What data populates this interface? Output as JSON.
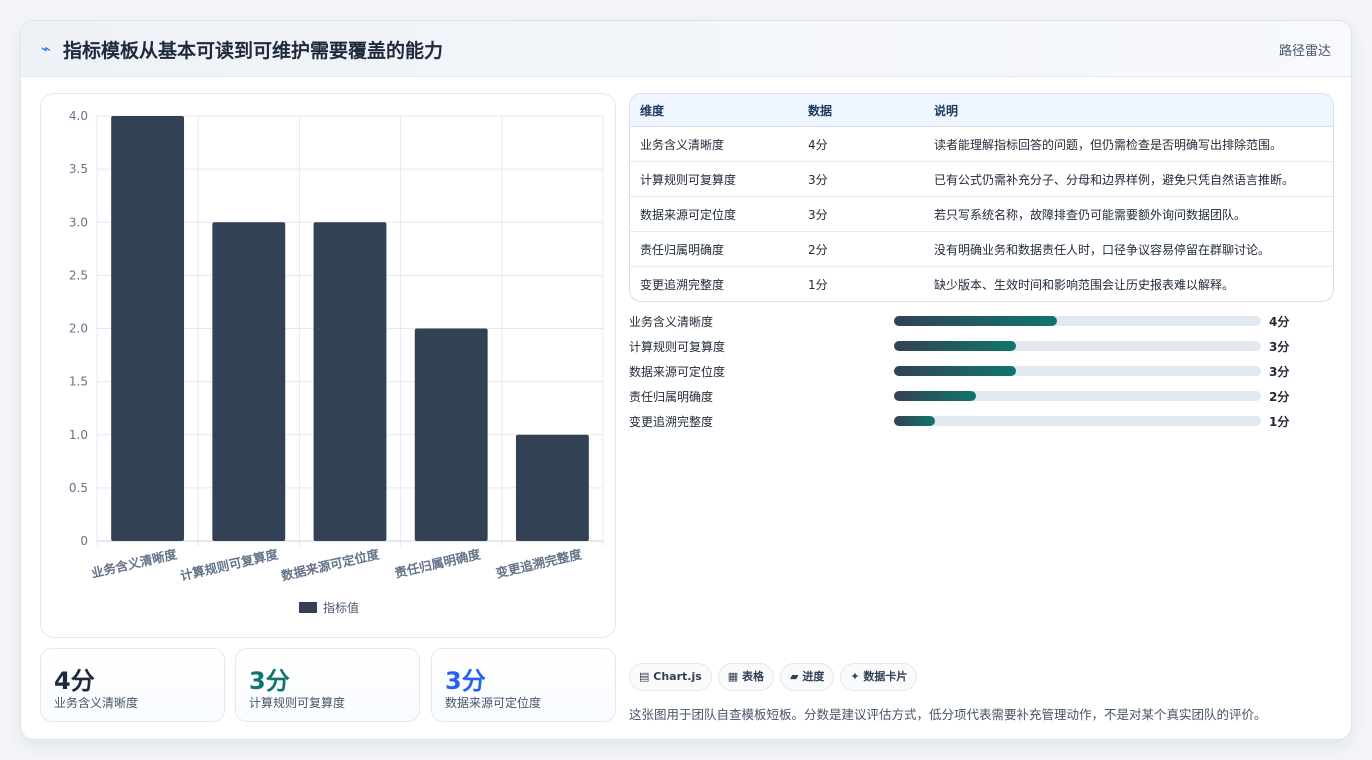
{
  "header": {
    "icon": "sparkline-icon",
    "title": "指标模板从基本可读到可维护需要覆盖的能力",
    "tag": "路径雷达"
  },
  "colors": {
    "bar": "#334155",
    "accent_teal": "#0f766e",
    "accent_blue": "#2563eb",
    "grid": "#e5e9ef"
  },
  "chart_data": {
    "type": "bar",
    "categories": [
      "业务含义清晰度",
      "计算规则可复算度",
      "数据来源可定位度",
      "责任归属明确度",
      "变更追溯完整度"
    ],
    "series": [
      {
        "name": "指标值",
        "values": [
          4,
          3,
          3,
          2,
          1
        ]
      }
    ],
    "ylim": [
      0,
      4
    ],
    "yticks": [
      "0",
      "0.5",
      "1.0",
      "1.5",
      "2.0",
      "2.5",
      "3.0",
      "3.5",
      "4.0"
    ],
    "ytick_values": [
      0,
      0.5,
      1.0,
      1.5,
      2.0,
      2.5,
      3.0,
      3.5,
      4.0
    ],
    "grid": true,
    "legend": "bottom"
  },
  "kpis": [
    {
      "value": "4分",
      "label": "业务含义清晰度",
      "color": "#1e293b"
    },
    {
      "value": "3分",
      "label": "计算规则可复算度",
      "color": "#0f766e"
    },
    {
      "value": "3分",
      "label": "数据来源可定位度",
      "color": "#2563eb"
    }
  ],
  "table": {
    "headers": [
      "维度",
      "数据",
      "说明"
    ],
    "rows": [
      [
        "业务含义清晰度",
        "4分",
        "读者能理解指标回答的问题，但仍需检查是否明确写出排除范围。"
      ],
      [
        "计算规则可复算度",
        "3分",
        "已有公式仍需补充分子、分母和边界样例，避免只凭自然语言推断。"
      ],
      [
        "数据来源可定位度",
        "3分",
        "若只写系统名称，故障排查仍可能需要额外询问数据团队。"
      ],
      [
        "责任归属明确度",
        "2分",
        "没有明确业务和数据责任人时，口径争议容易停留在群聊讨论。"
      ],
      [
        "变更追溯完整度",
        "1分",
        "缺少版本、生效时间和影响范围会让历史报表难以解释。"
      ]
    ]
  },
  "progress": {
    "max": 9,
    "items": [
      {
        "label": "业务含义清晰度",
        "value": 4,
        "value_label": "4分"
      },
      {
        "label": "计算规则可复算度",
        "value": 3,
        "value_label": "3分"
      },
      {
        "label": "数据来源可定位度",
        "value": 3,
        "value_label": "3分"
      },
      {
        "label": "责任归属明确度",
        "value": 2,
        "value_label": "2分"
      },
      {
        "label": "变更追溯完整度",
        "value": 1,
        "value_label": "1分"
      }
    ]
  },
  "chips": [
    {
      "icon": "chart-icon",
      "glyph": "▤",
      "label": "Chart.js"
    },
    {
      "icon": "table-icon",
      "glyph": "▦",
      "label": "表格"
    },
    {
      "icon": "progress-icon",
      "glyph": "▰",
      "label": "进度"
    },
    {
      "icon": "sparkle-icon",
      "glyph": "✦",
      "label": "数据卡片"
    }
  ],
  "footnote": "这张图用于团队自查模板短板。分数是建议评估方式，低分项代表需要补充管理动作，不是对某个真实团队的评价。"
}
